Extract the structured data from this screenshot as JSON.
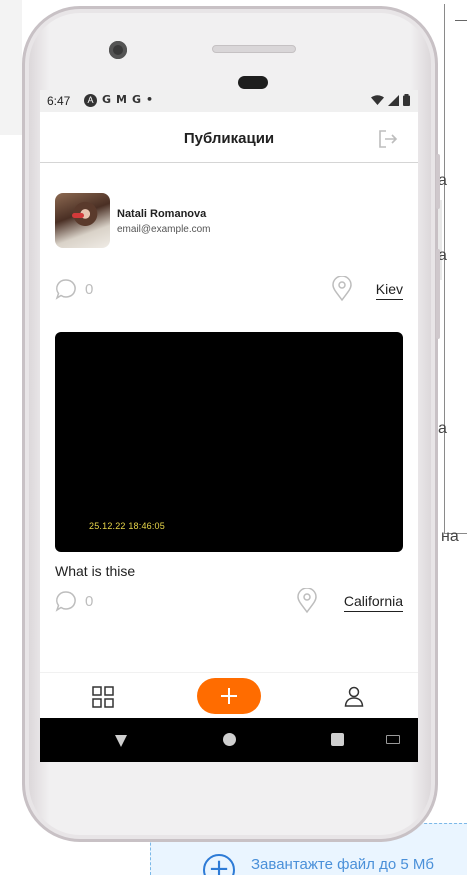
{
  "background": {
    "letters": [
      "а",
      "а",
      "а",
      "на"
    ],
    "upload_text": "Завантажте файл до 5 Мб",
    "upload_icon": "plus-circle-icon"
  },
  "status_bar": {
    "time": "6:47",
    "icons_left": [
      "A",
      "G",
      "M",
      "G",
      "•"
    ],
    "icons_right": [
      "wifi-icon",
      "signal-icon",
      "battery-icon"
    ]
  },
  "header": {
    "title": "Публикации",
    "logout_icon": "logout-icon"
  },
  "user": {
    "name": "Natali Romanova",
    "email": "email@example.com"
  },
  "posts": [
    {
      "comments": "0",
      "location": "Kiev"
    },
    {
      "timestamp": "25.12.22 18:46:05",
      "title": "What is thise",
      "comments": "0",
      "location": "California"
    }
  ],
  "bottom_nav": {
    "items": [
      "grid-icon",
      "add-icon",
      "profile-icon"
    ],
    "accent": "#ff6c00"
  },
  "colors": {
    "accent": "#ff6c00",
    "text": "#212121",
    "muted": "#bdbdbd"
  }
}
